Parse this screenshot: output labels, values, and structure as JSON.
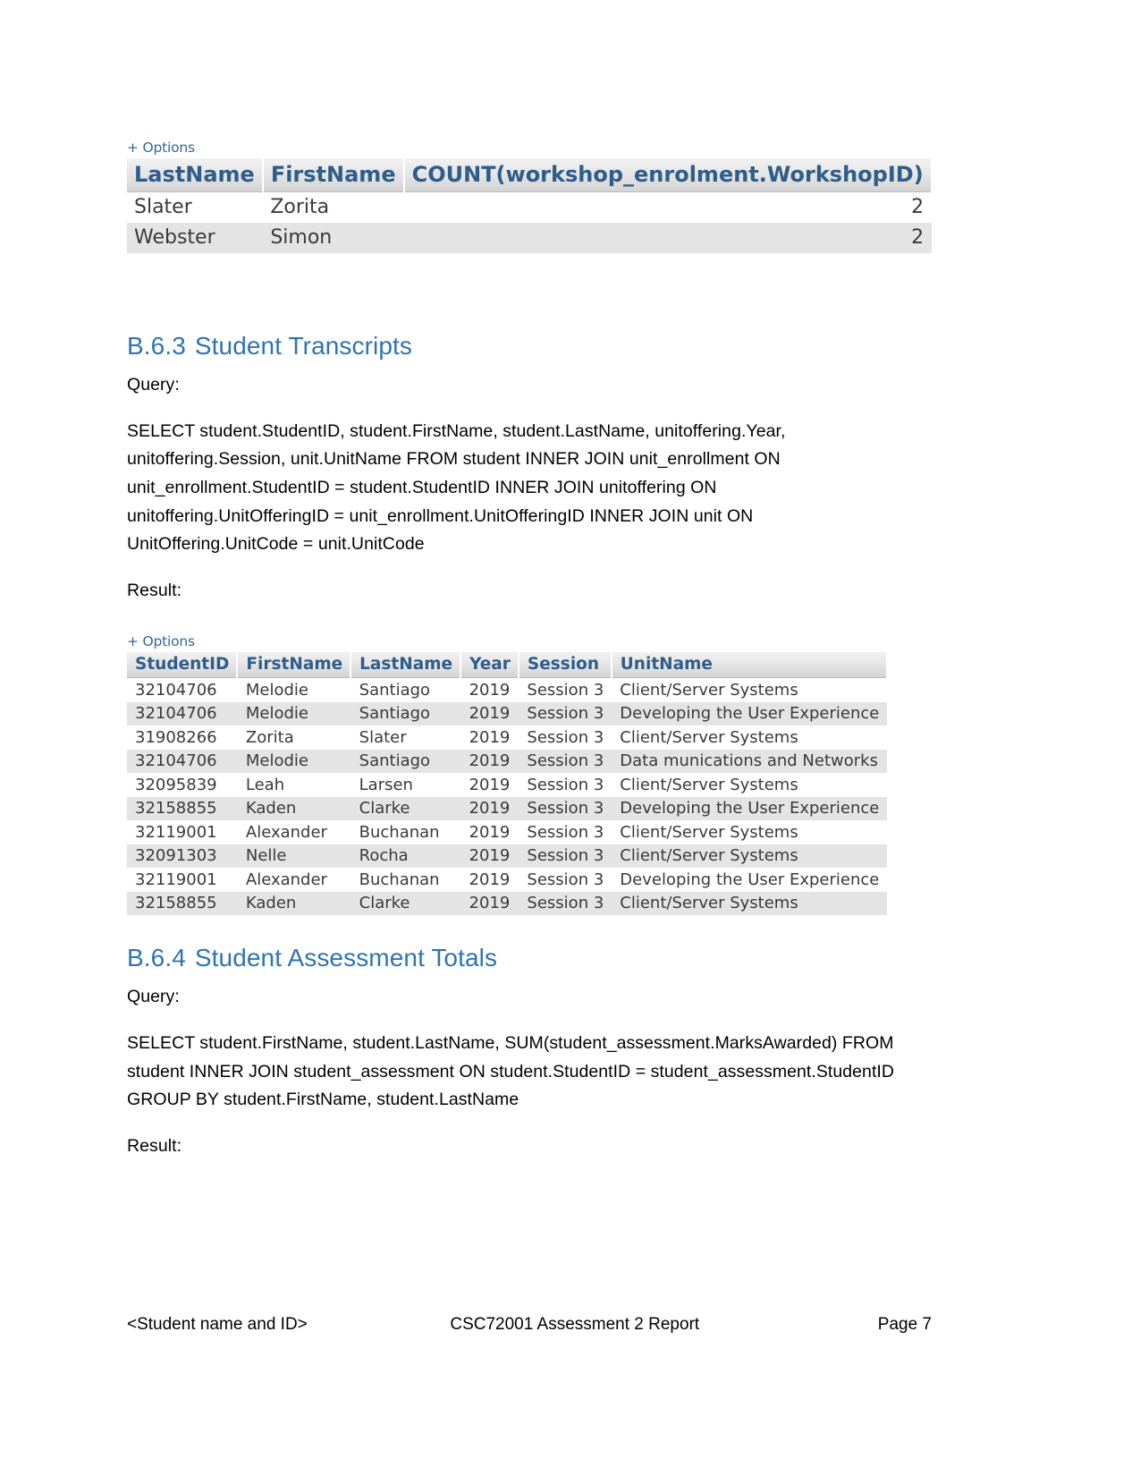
{
  "document": {
    "footer": {
      "left": "<Student name and ID>",
      "center": "CSC72001 Assessment 2 Report",
      "right": "Page 7"
    }
  },
  "result_table_workshop": {
    "options_label": "+ Options",
    "columns": [
      "LastName",
      "FirstName",
      "COUNT(workshop_enrolment.WorkshopID)"
    ],
    "rows": [
      {
        "LastName": "Slater",
        "FirstName": "Zorita",
        "Count": "2"
      },
      {
        "LastName": "Webster",
        "FirstName": "Simon",
        "Count": "2"
      }
    ]
  },
  "section_633": {
    "heading_number": "B.6.3",
    "heading_title": "Student Transcripts",
    "query_label": "Query:",
    "query_text": "SELECT student.StudentID, student.FirstName, student.LastName, unitoffering.Year, unitoffering.Session, unit.UnitName FROM student INNER JOIN unit_enrollment ON unit_enrollment.StudentID = student.StudentID INNER JOIN unitoffering ON unitoffering.UnitOfferingID = unit_enrollment.UnitOfferingID INNER JOIN unit ON UnitOffering.UnitCode = unit.UnitCode",
    "result_label": "Result:"
  },
  "result_table_transcripts": {
    "options_label": "+ Options",
    "columns": [
      "StudentID",
      "FirstName",
      "LastName",
      "Year",
      "Session",
      "UnitName"
    ],
    "rows": [
      [
        "32104706",
        "Melodie",
        "Santiago",
        "2019",
        "Session 3",
        "Client/Server Systems"
      ],
      [
        "32104706",
        "Melodie",
        "Santiago",
        "2019",
        "Session 3",
        "Developing the User Experience"
      ],
      [
        "31908266",
        "Zorita",
        "Slater",
        "2019",
        "Session 3",
        "Client/Server Systems"
      ],
      [
        "32104706",
        "Melodie",
        "Santiago",
        "2019",
        "Session 3",
        "Data munications and Networks"
      ],
      [
        "32095839",
        "Leah",
        "Larsen",
        "2019",
        "Session 3",
        "Client/Server Systems"
      ],
      [
        "32158855",
        "Kaden",
        "Clarke",
        "2019",
        "Session 3",
        "Developing the User Experience"
      ],
      [
        "32119001",
        "Alexander",
        "Buchanan",
        "2019",
        "Session 3",
        "Client/Server Systems"
      ],
      [
        "32091303",
        "Nelle",
        "Rocha",
        "2019",
        "Session 3",
        "Client/Server Systems"
      ],
      [
        "32119001",
        "Alexander",
        "Buchanan",
        "2019",
        "Session 3",
        "Developing the User Experience"
      ],
      [
        "32158855",
        "Kaden",
        "Clarke",
        "2019",
        "Session 3",
        "Client/Server Systems"
      ]
    ]
  },
  "section_634": {
    "heading_number": "B.6.4",
    "heading_title": "Student Assessment Totals",
    "query_label": "Query:",
    "query_text": "SELECT student.FirstName, student.LastName, SUM(student_assessment.MarksAwarded) FROM student INNER JOIN student_assessment ON student.StudentID = student_assessment.StudentID GROUP BY student.FirstName, student.LastName",
    "result_label": "Result:"
  },
  "colors": {
    "heading_blue": "#2e74b5",
    "table_header_blue": "#2f5d8a",
    "options_link_blue": "#336699",
    "row_stripe": "#e4e4e4"
  }
}
